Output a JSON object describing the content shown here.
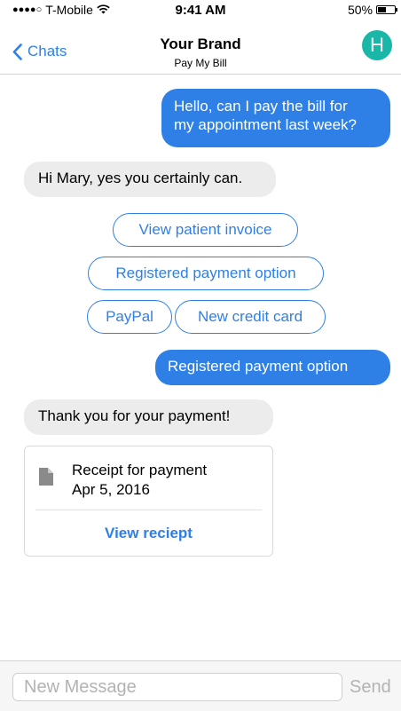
{
  "status_bar": {
    "signal": "●●●●○",
    "carrier": "T-Mobile",
    "wifi_icon": "wifi-icon",
    "time": "9:41 AM",
    "battery_percent": "50%",
    "battery_level": 0.5
  },
  "nav": {
    "back_label": "Chats",
    "title": "Your Brand",
    "subtitle": "Pay My Bill",
    "avatar_initial": "H",
    "avatar_color": "#1ab7a8"
  },
  "messages": {
    "outgoing_1_line1": "Hello, can I pay the bill for",
    "outgoing_1_line2": "my appointment last week?",
    "incoming_1": "Hi Mary, yes you certainly can.",
    "options": {
      "view_invoice": "View patient invoice",
      "registered_payment": "Registered payment option",
      "paypal": "PayPal",
      "new_card": "New credit card"
    },
    "outgoing_2": "Registered payment option",
    "incoming_2": "Thank you for your payment!",
    "receipt": {
      "title": "Receipt for payment",
      "date": "Apr 5, 2016",
      "action": "View reciept"
    }
  },
  "input_bar": {
    "placeholder": "New Message",
    "value": "",
    "send_label": "Send"
  },
  "colors": {
    "accent": "#2f80e6",
    "incoming_bubble": "#ececec"
  }
}
